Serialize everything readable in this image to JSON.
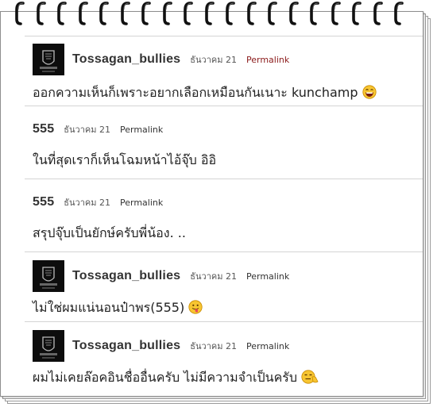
{
  "comments": [
    {
      "author": "Tossagan_bullies",
      "date": "ธันวาคม 21",
      "permalink": "Permalink",
      "text": "ออกความเห็นก็เพราะอยากเลือกเหมือนกันเนาะ kunchamp",
      "has_avatar": true,
      "emoji": "laughing-emoji"
    },
    {
      "author": "555",
      "date": "ธันวาคม 21",
      "permalink": "Permalink",
      "text": "ในที่สุดเราก็เห็นโฉมหน้าไอ้จุ๊บ อิอิ",
      "has_avatar": false
    },
    {
      "author": "555",
      "date": "ธันวาคม 21",
      "permalink": "Permalink",
      "text": "สรุปจุ๊บเป็นยักษ์ครับพี่น้อง. ..",
      "has_avatar": false
    },
    {
      "author": "Tossagan_bullies",
      "date": "ธันวาคม 21",
      "permalink": "Permalink",
      "text": "ไม่ใช่ผมแน่นอนป๋าพร(555)",
      "has_avatar": true,
      "emoji": "tongue-out-emoji"
    },
    {
      "author": "Tossagan_bullies",
      "date": "ธันวาคม 21",
      "permalink": "Permalink",
      "text": "ผมไม่เคยล๊อคอินชื่ออื่นครับ ไม่มีความจำเป็นครับ",
      "has_avatar": true,
      "emoji": "thinking-emoji"
    }
  ],
  "colors": {
    "permalink_first": "#8b1a1a",
    "permalink": "#333333",
    "author": "#333333",
    "divider": "#d4d4d4"
  },
  "icons": [
    "spiral-ring-icon",
    "avatar-crest-icon",
    "laughing-emoji",
    "tongue-out-emoji",
    "thinking-emoji"
  ]
}
